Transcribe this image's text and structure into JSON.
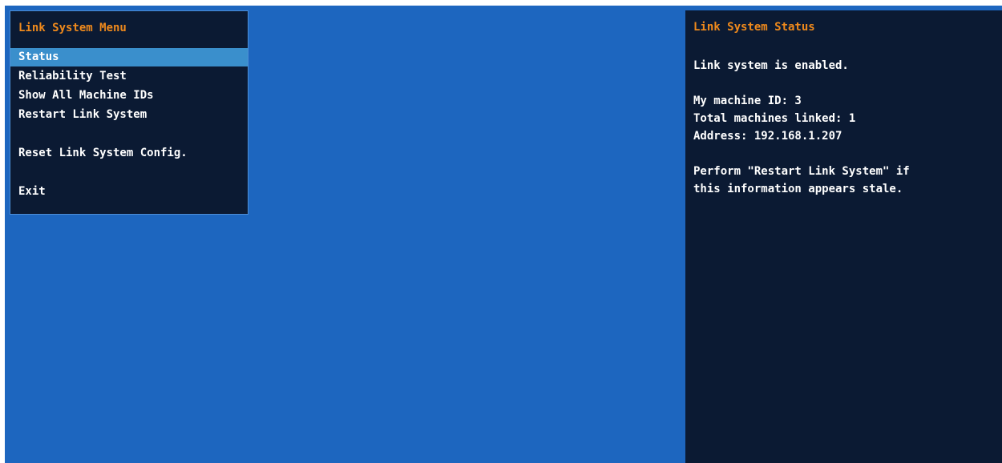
{
  "menu": {
    "title": "Link System Menu",
    "items": [
      {
        "label": "Status",
        "selected": true
      },
      {
        "label": "Reliability Test"
      },
      {
        "label": "Show All Machine IDs"
      },
      {
        "label": "Restart Link System"
      },
      {
        "label": "Reset Link System Config."
      },
      {
        "label": "Exit"
      }
    ]
  },
  "status": {
    "title": "Link System Status",
    "enabled_text": "Link system is enabled.",
    "machine_id": "My machine ID: 3",
    "total_linked": "Total machines linked: 1",
    "address": "Address: 192.168.1.207",
    "hint_line1": "Perform \"Restart Link System\" if",
    "hint_line2": "this information appears stale."
  },
  "colors": {
    "background": "#1d66bf",
    "panel": "#0b1a33",
    "title": "#f08a1c",
    "highlight": "#3a8fcc",
    "text": "#ffffff"
  }
}
